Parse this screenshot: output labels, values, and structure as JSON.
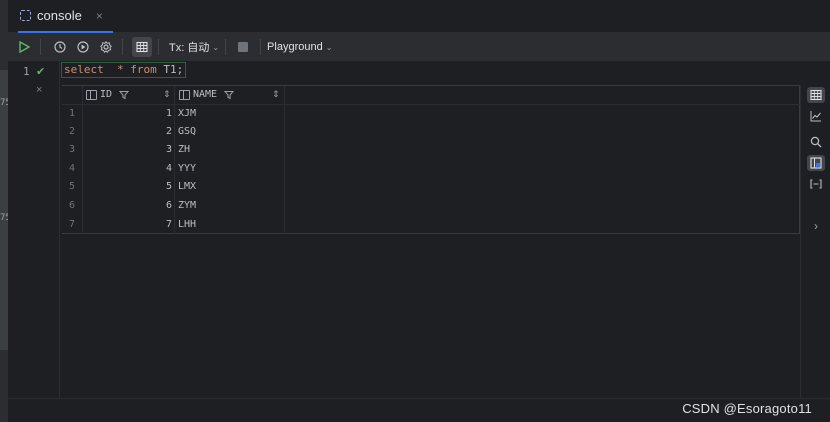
{
  "tab": {
    "title": "console",
    "close": "×"
  },
  "toolbar": {
    "tx_label": "Tx: 自动",
    "playground_label": "Playground",
    "chevron": "⌄"
  },
  "editor": {
    "line_number": "1",
    "code": {
      "kw1": "select",
      "star": "*",
      "kw2": "from",
      "table": "T1",
      "semicolon": ";"
    }
  },
  "left_edge": {
    "label_a": "75",
    "label_b": "75"
  },
  "grid": {
    "columns": [
      {
        "name": "ID"
      },
      {
        "name": "NAME"
      }
    ],
    "rows": [
      {
        "n": "1",
        "id": "1",
        "name": "XJM"
      },
      {
        "n": "2",
        "id": "2",
        "name": "GSQ"
      },
      {
        "n": "3",
        "id": "3",
        "name": "ZH"
      },
      {
        "n": "4",
        "id": "4",
        "name": "YYY"
      },
      {
        "n": "5",
        "id": "5",
        "name": "LMX"
      },
      {
        "n": "6",
        "id": "6",
        "name": "ZYM"
      },
      {
        "n": "7",
        "id": "7",
        "name": "LHH"
      }
    ]
  },
  "result_close": "×",
  "side_expand": "›",
  "watermark": "CSDN @Esoragoto11",
  "colors": {
    "accent": "#3574f0",
    "run_green": "#5fb865",
    "keyword": "#cf8e6d"
  },
  "icons": {
    "run": "play-icon",
    "history": "clock-icon",
    "explain": "explain-icon",
    "settings": "gear-icon",
    "table": "table-icon",
    "stop": "stop-icon",
    "filter": "filter-icon"
  }
}
